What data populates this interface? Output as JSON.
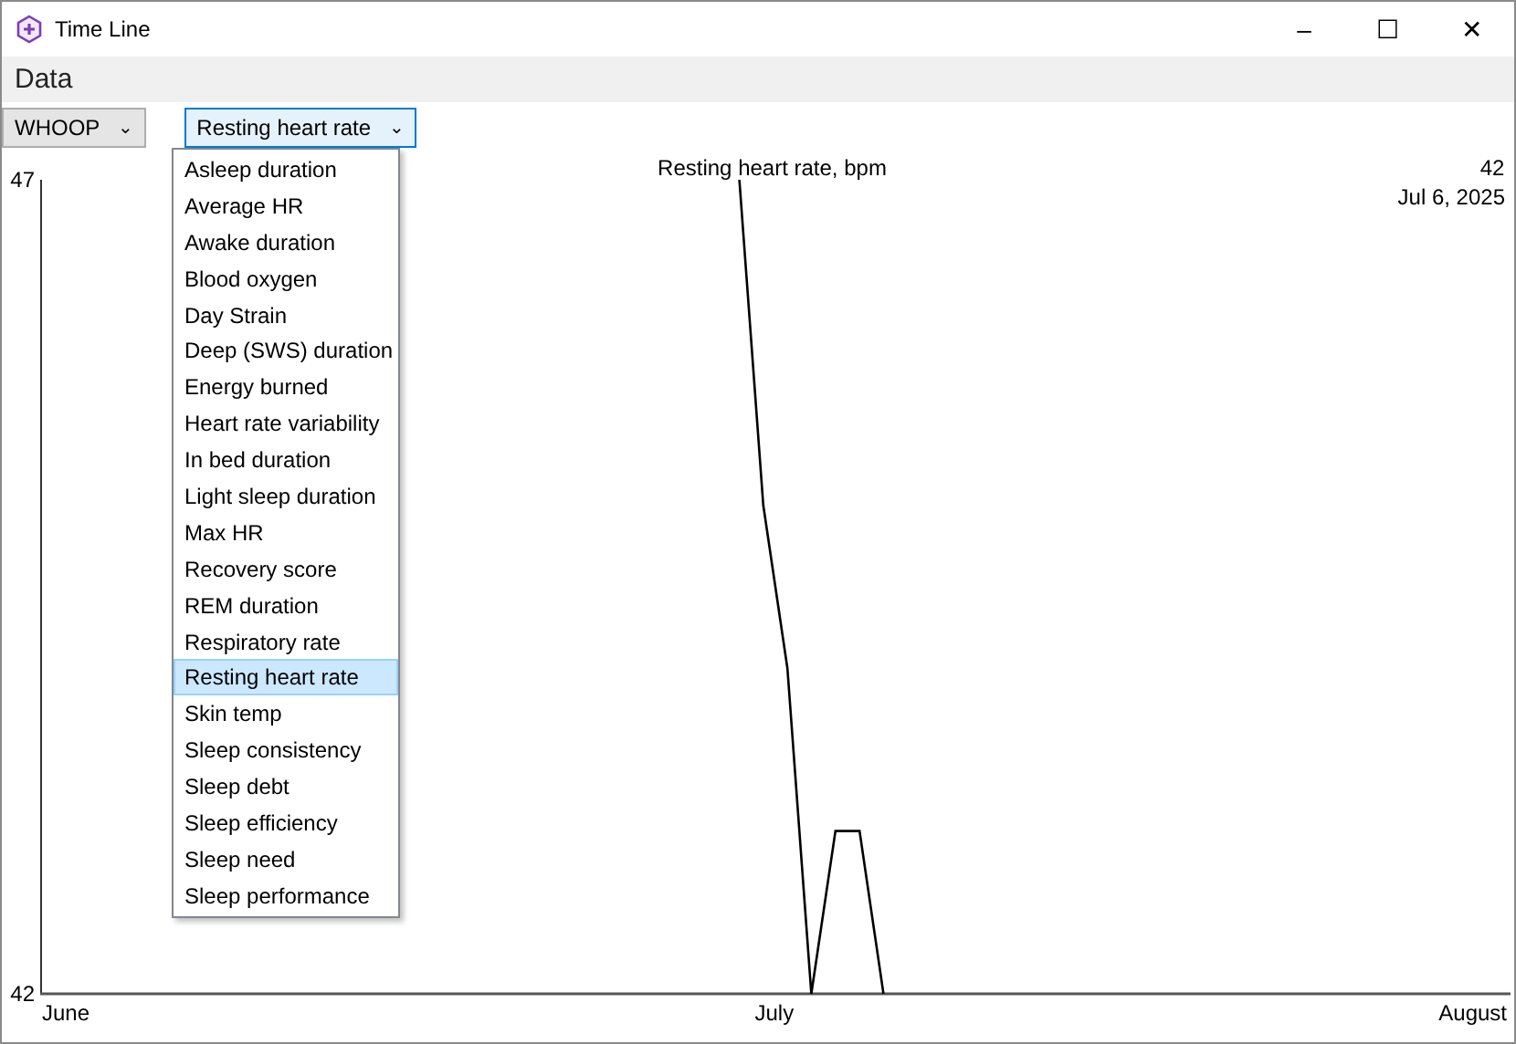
{
  "window": {
    "title": "Time Line",
    "controls": [
      "–",
      "☐",
      "✕"
    ]
  },
  "menu": [
    {
      "label": "Data"
    }
  ],
  "source_combo": {
    "value": "WHOOP",
    "caret": "⌄"
  },
  "metric_combo": {
    "value": "Resting heart rate",
    "caret": "⌄",
    "expanded": true,
    "options": [
      {
        "label": "Asleep duration",
        "selected": false
      },
      {
        "label": "Average HR",
        "selected": false
      },
      {
        "label": "Awake duration",
        "selected": false
      },
      {
        "label": "Blood oxygen",
        "selected": false
      },
      {
        "label": "Day Strain",
        "selected": false
      },
      {
        "label": "Deep (SWS) duration",
        "selected": false
      },
      {
        "label": "Energy burned",
        "selected": false
      },
      {
        "label": "Heart rate variability",
        "selected": false
      },
      {
        "label": "In bed duration",
        "selected": false
      },
      {
        "label": "Light sleep duration",
        "selected": false
      },
      {
        "label": "Max HR",
        "selected": false
      },
      {
        "label": "Recovery score",
        "selected": false
      },
      {
        "label": "REM duration",
        "selected": false
      },
      {
        "label": "Respiratory rate",
        "selected": false
      },
      {
        "label": "Resting heart rate",
        "selected": true
      },
      {
        "label": "Skin temp",
        "selected": false
      },
      {
        "label": "Sleep consistency",
        "selected": false
      },
      {
        "label": "Sleep debt",
        "selected": false
      },
      {
        "label": "Sleep efficiency",
        "selected": false
      },
      {
        "label": "Sleep need",
        "selected": false
      },
      {
        "label": "Sleep performance",
        "selected": false
      }
    ]
  },
  "readout": {
    "value": "42",
    "date": "Jul 6, 2025"
  },
  "chart": {
    "chart_data": {
      "type": "line",
      "title": "Resting heart rate, bpm",
      "categories": [
        "June",
        null,
        null,
        null,
        null,
        null,
        null,
        null,
        null,
        null,
        null,
        null,
        null,
        null,
        null,
        null,
        null,
        null,
        null,
        null,
        null,
        null,
        null,
        null,
        null,
        null,
        null,
        null,
        null,
        null,
        "July",
        null,
        null,
        null,
        null,
        null,
        null,
        null,
        null,
        null,
        null,
        null,
        null,
        null,
        null,
        null,
        null,
        null,
        null,
        null,
        null,
        null,
        null,
        null,
        null,
        null,
        null,
        null,
        null,
        null,
        null,
        "August"
      ],
      "series": [
        {
          "color": "#000000",
          "values": [
            null,
            null,
            null,
            null,
            null,
            null,
            null,
            null,
            null,
            null,
            null,
            null,
            null,
            null,
            null,
            null,
            null,
            null,
            null,
            null,
            null,
            null,
            null,
            null,
            null,
            null,
            null,
            null,
            null,
            47,
            45,
            44,
            42,
            43,
            43,
            42,
            null,
            null,
            null,
            null,
            null,
            null,
            null,
            null,
            null,
            null,
            null,
            null,
            null,
            null,
            null,
            null,
            null,
            null,
            null,
            null,
            null,
            null,
            null,
            null,
            null,
            null
          ]
        }
      ],
      "ylim": [
        42,
        47
      ],
      "yticks": [
        42,
        47
      ]
    }
  }
}
